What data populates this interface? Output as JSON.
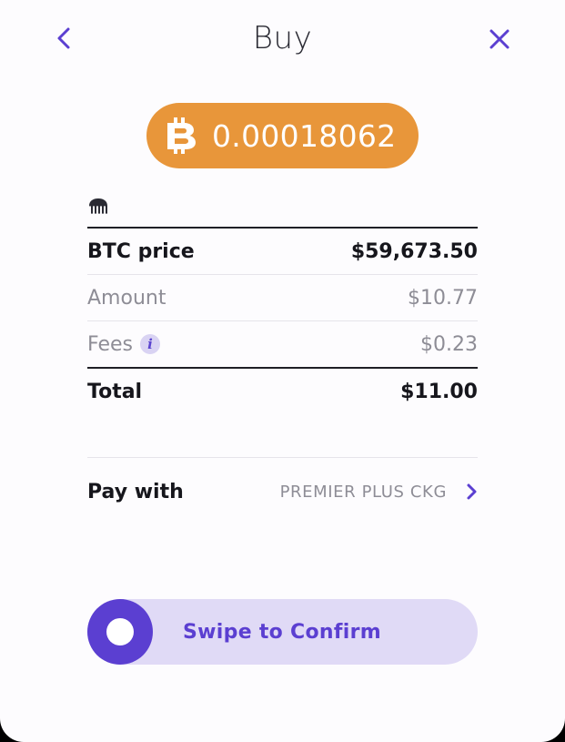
{
  "header": {
    "title": "Buy"
  },
  "order": {
    "btc_amount": "0.00018062",
    "pill_color": "#e8963a"
  },
  "details": {
    "btc_price_label": "BTC price",
    "btc_price_value": "$59,673.50",
    "amount_label": "Amount",
    "amount_value": "$10.77",
    "fees_label": "Fees",
    "fees_value": "$0.23",
    "info_glyph": "i",
    "total_label": "Total",
    "total_value": "$11.00"
  },
  "payment": {
    "label": "Pay with",
    "method": "PREMIER PLUS CKG"
  },
  "confirm": {
    "swipe_label": "Swipe to Confirm",
    "accent_color": "#5b3fd1",
    "track_color": "#e0daf6"
  },
  "icons": {
    "back": "chevron-left-icon",
    "close": "close-icon",
    "asset": "bitcoin-icon",
    "exchange": "kraken-icon",
    "info": "info-icon",
    "pay_chevron": "chevron-right-icon"
  }
}
